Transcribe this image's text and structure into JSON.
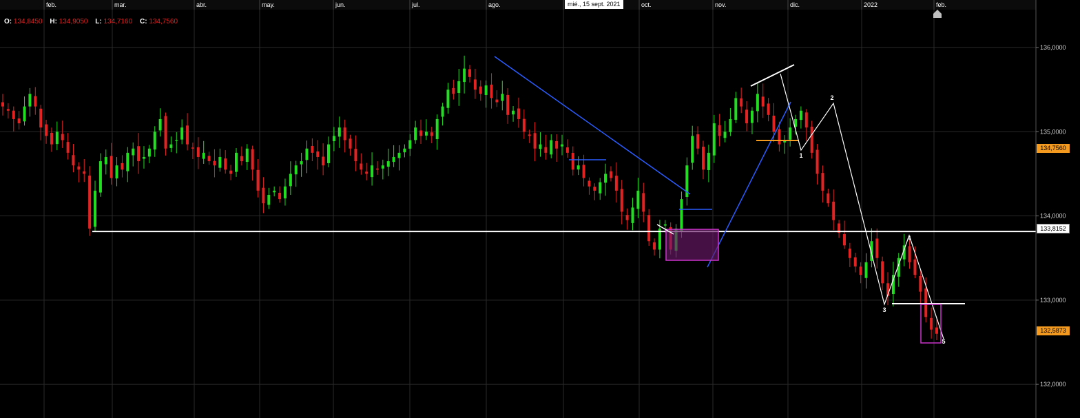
{
  "ohlc": {
    "o_label": "O:",
    "o_value": "134,8450",
    "h_label": "H:",
    "h_value": "134,9050",
    "l_label": "L:",
    "l_value": "134,7160",
    "c_label": "C:",
    "c_value": "134,7560"
  },
  "crosshair_date": "mié., 15 sept. 2021",
  "price_tags": {
    "last": "134,7560",
    "level": "133,8152",
    "current": "132,5873"
  },
  "colors": {
    "up": "#22dd22",
    "down": "#e32222",
    "grid": "#2a2a2a",
    "trendline_blue": "#2a5cff",
    "white": "#ffffff",
    "orange": "#f39a1f",
    "magenta": "#cc33cc"
  },
  "chart_data": {
    "type": "candlestick",
    "x_tick_labels": [
      "feb.",
      "mar.",
      "abr.",
      "may.",
      "jun.",
      "jul.",
      "ago.",
      "sept.",
      "oct.",
      "nov.",
      "dic.",
      "2022",
      "feb."
    ],
    "y_tick_labels": [
      "136,0000",
      "135,0000",
      "134,0000",
      "133,0000",
      "132,0000"
    ],
    "ylim": [
      131.6,
      136.45
    ],
    "grid": true,
    "horizontal_level": 133.8152,
    "wave_labels": [
      "1",
      "2",
      "3",
      "4",
      "5"
    ],
    "close_path": [
      135.3,
      135.25,
      135.15,
      135.1,
      135.3,
      135.45,
      135.3,
      135.05,
      134.95,
      134.85,
      135.0,
      134.9,
      134.75,
      134.6,
      134.55,
      134.5,
      133.85,
      134.3,
      134.65,
      134.7,
      134.45,
      134.6,
      134.55,
      134.75,
      134.8,
      134.65,
      134.7,
      134.8,
      135.0,
      135.15,
      134.8,
      134.85,
      134.9,
      135.05,
      134.85,
      134.8,
      134.7,
      134.75,
      134.65,
      134.6,
      134.7,
      134.55,
      134.5,
      134.75,
      134.65,
      134.8,
      134.55,
      134.3,
      134.15,
      134.25,
      134.3,
      134.2,
      134.35,
      134.5,
      134.6,
      134.65,
      134.8,
      134.75,
      134.7,
      134.6,
      134.85,
      134.95,
      135.05,
      134.9,
      134.8,
      134.65,
      134.55,
      134.5,
      134.6,
      134.55,
      134.6,
      134.65,
      134.7,
      134.75,
      134.8,
      134.9,
      135.05,
      134.95,
      135.0,
      134.95,
      135.15,
      135.3,
      135.5,
      135.45,
      135.6,
      135.75,
      135.65,
      135.5,
      135.45,
      135.55,
      135.4,
      135.35,
      135.45,
      135.2,
      135.25,
      135.15,
      135.0,
      134.95,
      134.8,
      134.85,
      134.75,
      134.9,
      134.8,
      134.85,
      134.75,
      134.55,
      134.6,
      134.45,
      134.35,
      134.3,
      134.4,
      134.5,
      134.45,
      134.3,
      134.05,
      133.95,
      134.1,
      134.3,
      134.05,
      133.7,
      133.6,
      133.85,
      133.9,
      133.6,
      133.85,
      134.2,
      134.6,
      134.95,
      134.8,
      134.55,
      134.75,
      135.1,
      134.95,
      135.0,
      135.15,
      135.4,
      135.3,
      135.1,
      135.25,
      135.45,
      135.3,
      135.2,
      135.0,
      134.85,
      134.9,
      135.05,
      135.15,
      135.25,
      135.05,
      134.75,
      134.5,
      134.3,
      134.15,
      133.95,
      133.8,
      133.65,
      133.5,
      133.4,
      133.3,
      133.45,
      133.7,
      133.5,
      133.2,
      133.05,
      133.3,
      133.5,
      133.65,
      133.45,
      133.3,
      133.1,
      132.8,
      132.65,
      132.6
    ]
  }
}
